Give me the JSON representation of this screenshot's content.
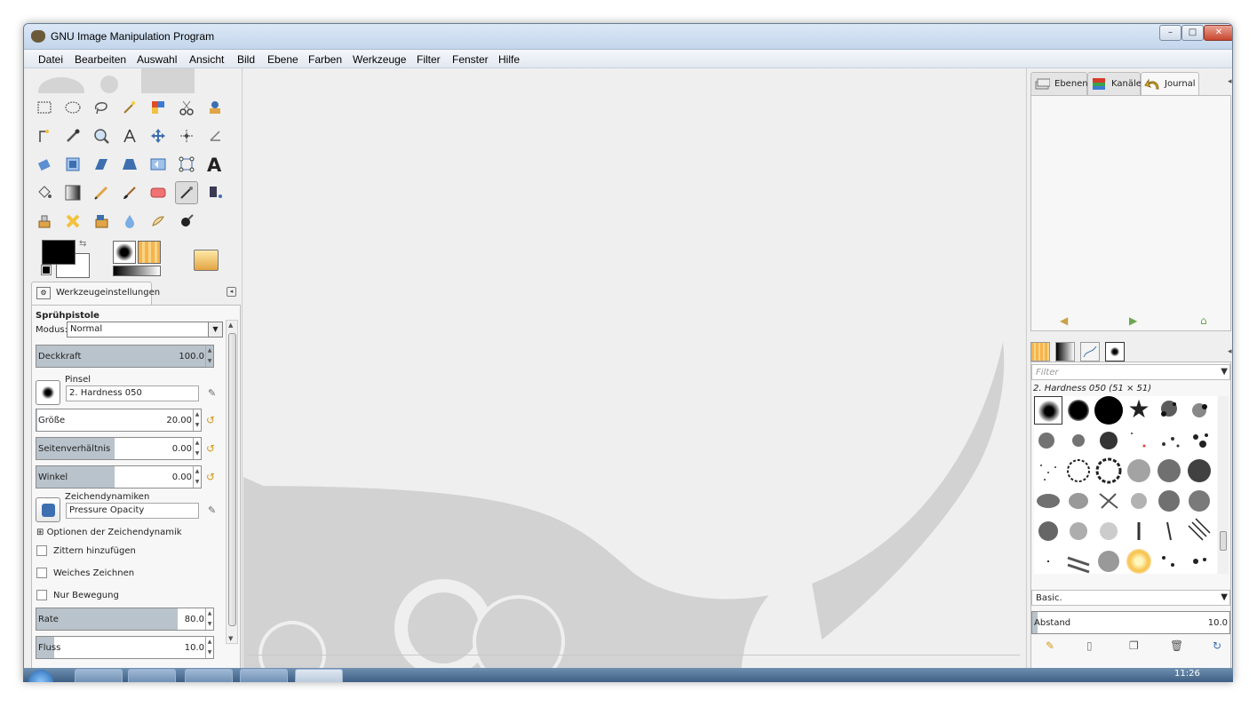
{
  "window": {
    "title": "GNU Image Manipulation Program"
  },
  "menu": [
    "Datei",
    "Bearbeiten",
    "Auswahl",
    "Ansicht",
    "Bild",
    "Ebene",
    "Farben",
    "Werkzeuge",
    "Filter",
    "Fenster",
    "Hilfe"
  ],
  "toolbox": {
    "tab_label": "Werkzeugeinstellungen",
    "options_title": "Sprühpistole",
    "mode_label": "Modus:",
    "mode_value": "Normal",
    "opacity": {
      "label": "Deckkraft",
      "value": "100.0",
      "fill_pct": 100
    },
    "brush": {
      "label": "Pinsel",
      "value": "2. Hardness 050"
    },
    "size": {
      "label": "Größe",
      "value": "20.00"
    },
    "aspect": {
      "label": "Seitenverhältnis",
      "value": "0.00"
    },
    "angle": {
      "label": "Winkel",
      "value": "0.00"
    },
    "dynamics": {
      "label": "Zeichendynamiken",
      "value": "Pressure Opacity"
    },
    "dyn_options": "Optionen der Zeichendynamik",
    "jitter": "Zittern hinzufügen",
    "smooth": "Weiches Zeichnen",
    "motion_only": "Nur Bewegung",
    "rate": {
      "label": "Rate",
      "value": "80.0",
      "fill_pct": 80
    },
    "flow": {
      "label": "Fluss",
      "value": "10.0",
      "fill_pct": 10
    }
  },
  "docks": {
    "tabs": {
      "layers": "Ebenen",
      "channels": "Kanäle",
      "history": "Journal"
    },
    "filter_placeholder": "Filter",
    "brush_name": "2. Hardness 050 (51 × 51)",
    "brush_set": "Basic.",
    "spacing": {
      "label": "Abstand",
      "value": "10.0"
    }
  },
  "taskbar": {
    "clock": "11:26"
  },
  "colors": {
    "accent": "#b9c3cb",
    "window_border": "#6c7d92"
  }
}
